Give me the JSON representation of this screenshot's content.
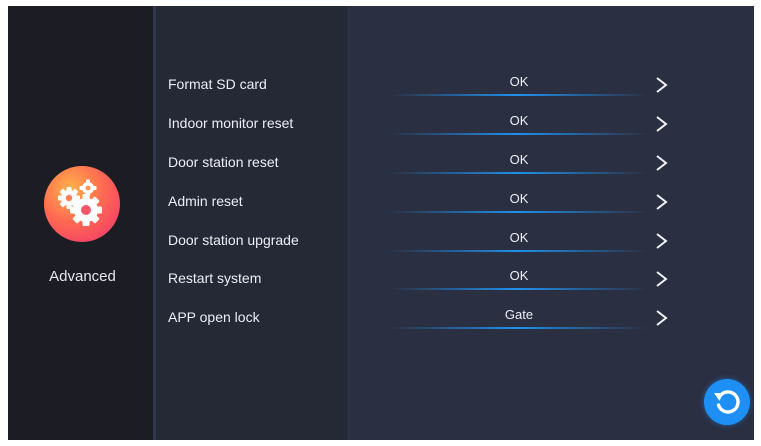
{
  "sidebar": {
    "app_icon": "gears-icon",
    "app_label": "Advanced"
  },
  "settings": {
    "rows": [
      {
        "label": "Format SD card",
        "value": "OK"
      },
      {
        "label": "Indoor monitor reset",
        "value": "OK"
      },
      {
        "label": "Door station reset",
        "value": "OK"
      },
      {
        "label": "Admin reset",
        "value": "OK"
      },
      {
        "label": "Door station upgrade",
        "value": "OK"
      },
      {
        "label": "Restart system",
        "value": "OK"
      },
      {
        "label": "APP open lock",
        "value": "Gate"
      }
    ]
  },
  "footer": {
    "refresh_icon": "refresh-icon"
  },
  "colors": {
    "background": "#2b2f42",
    "sidebar": "#1b1c24",
    "list_panel": "#252936",
    "accent_blue": "#1e90f5",
    "app_icon_gradient": [
      "#ffb14a",
      "#ff6a52",
      "#f0306e"
    ]
  }
}
